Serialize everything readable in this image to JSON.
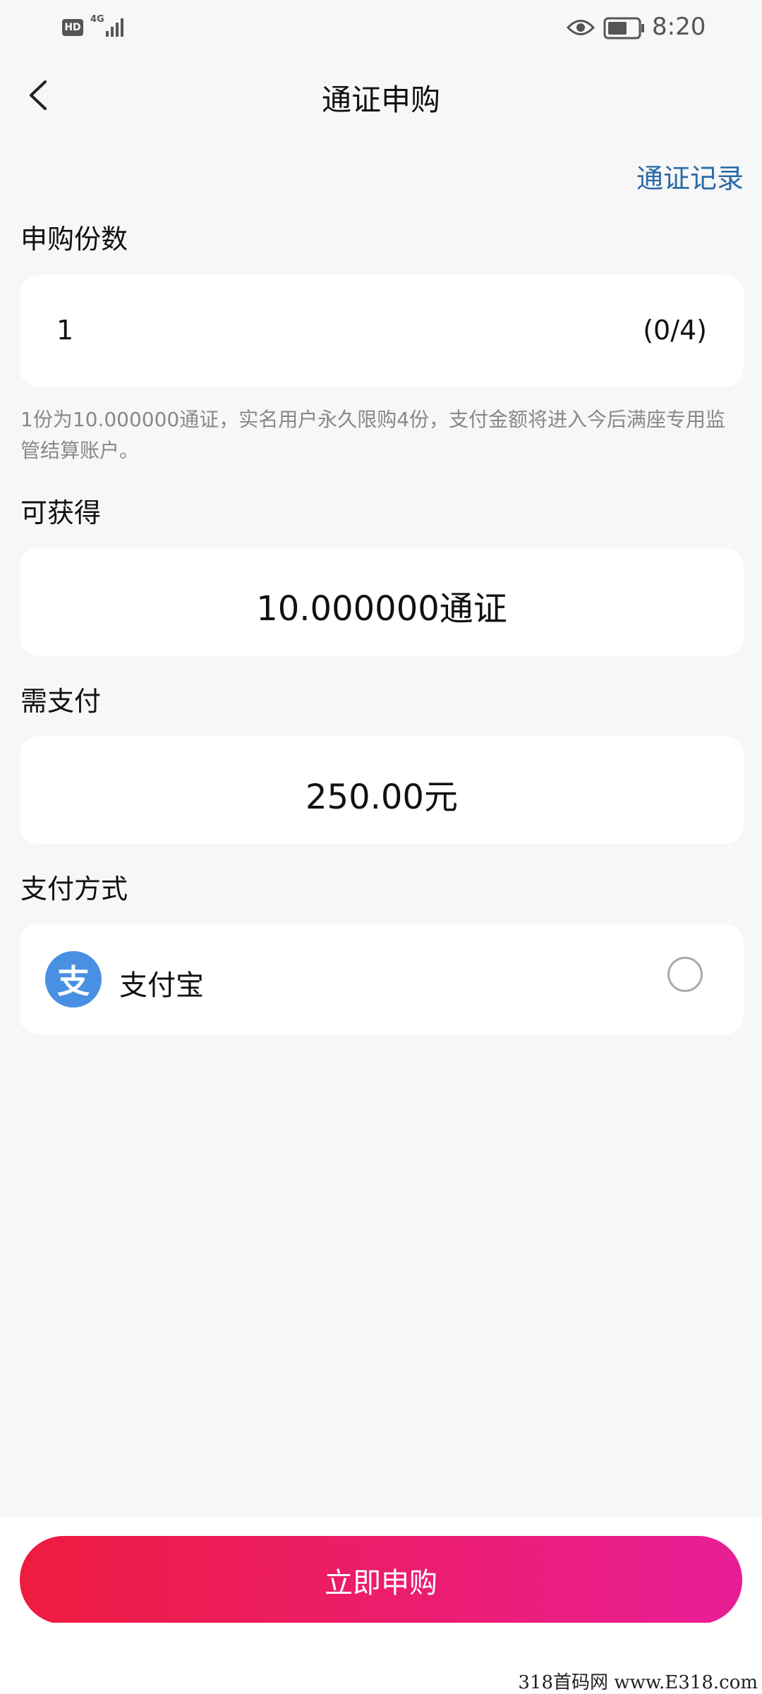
{
  "status_bar": {
    "hd": "HD",
    "network": "4G",
    "time": "8:20"
  },
  "nav": {
    "title": "通证申购"
  },
  "records_link": "通证记录",
  "quantity": {
    "label": "申购份数",
    "value": "1",
    "count": "(0/4)",
    "note": "1份为10.000000通证，实名用户永久限购4份，支付金额将进入今后满座专用监管结算账户。"
  },
  "obtain": {
    "label": "可获得",
    "value": "10.000000通证"
  },
  "pay": {
    "label": "需支付",
    "value": "250.00元"
  },
  "payment_method": {
    "label": "支付方式",
    "option_name": "支付宝",
    "logo_glyph": "支",
    "selected": false
  },
  "submit_label": "立即申购",
  "watermark": "318首码网 www.E318.com",
  "colors": {
    "link": "#2b6aa8",
    "alipay_blue": "#4a90e2",
    "button_start": "#ee1c3f",
    "button_end": "#e91e97"
  }
}
